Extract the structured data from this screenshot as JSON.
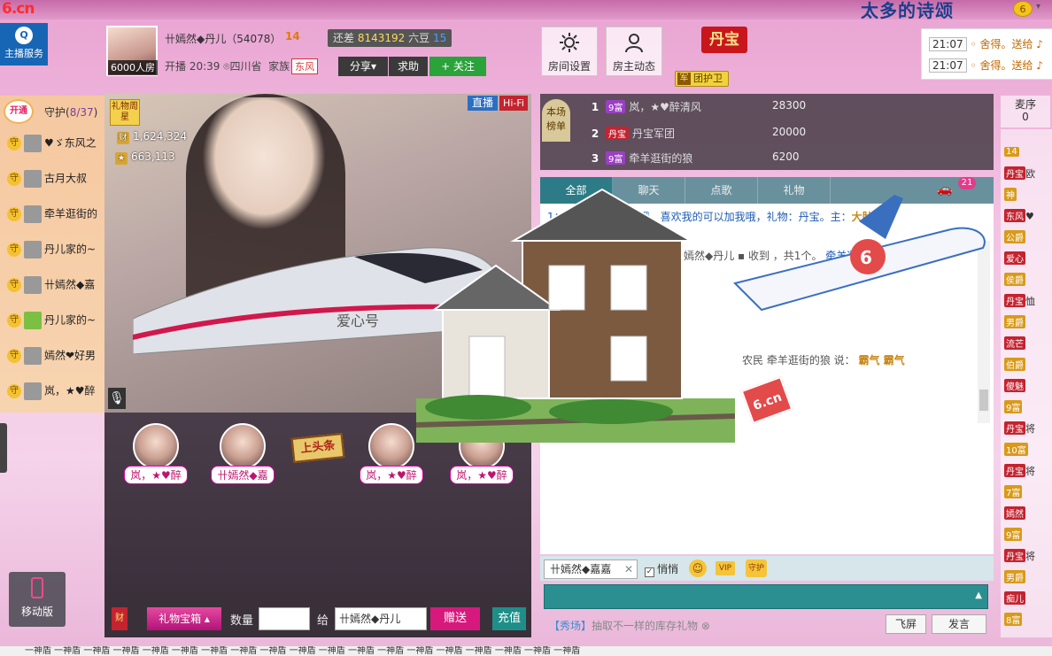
{
  "topbar": {
    "logo": "6.cn",
    "banner": "太多的诗颂",
    "coin_label": "6"
  },
  "anchor_service": {
    "label": "主播服务",
    "icon": "qq-icon"
  },
  "host": {
    "room_size": "6000人房",
    "name": "卄嫣然◆丹儿（54078）",
    "level": "14",
    "diff_prefix": "还差",
    "diff_value": "8143192",
    "diff_unit": "六豆",
    "next_level": "15",
    "live_time": "开播 20:39",
    "location": "四川省",
    "family_label": "家族",
    "family_name": "东风",
    "share": "分享▾",
    "ask": "求助",
    "follow": "+ 关注"
  },
  "tools": {
    "room_settings": "房间设置",
    "host_updates": "房主动态",
    "danbao": "丹宝",
    "guard": "团护卫",
    "guard_badge": "军"
  },
  "feed": [
    {
      "time": "21:07",
      "text": "◦ 舍得。送给 ♪"
    },
    {
      "time": "21:07",
      "text": "◦ 舍得。送给 ♪"
    }
  ],
  "guards": {
    "open_label": "开通",
    "title": "守护(",
    "count": "8/37",
    "close": ")",
    "items": [
      {
        "name": "♥ゞ东风之"
      },
      {
        "name": "古月大叔"
      },
      {
        "name": "牵羊逛街的"
      },
      {
        "name": "丹儿家的~"
      },
      {
        "name": "卄嫣然◆嘉"
      },
      {
        "name": "丹儿家的~"
      },
      {
        "name": "嫣然❤好男"
      },
      {
        "name": "岚，★♥醉"
      }
    ]
  },
  "video": {
    "gift_star": "礼物周星",
    "stat1": "1,624,324",
    "stat2": "663,113",
    "live_tag": "直播",
    "hifi_tag": "Hi-Fi",
    "train_label": "爱心号"
  },
  "stage": {
    "seats": [
      {
        "name": "岚，★♥醉"
      },
      {
        "name": "卄嫣然◆嘉"
      },
      {
        "name": "岚，★♥醉"
      },
      {
        "name": "岚，★♥醉"
      }
    ],
    "headline": "上头条"
  },
  "giftbar": {
    "treasure": "礼物宝箱",
    "qty_label": "数量",
    "to_label": "给",
    "to_value": "卄嫣然◆丹儿",
    "give": "赠送",
    "recharge": "充值",
    "fortune": "财"
  },
  "ranking": {
    "tab": "本场榜单",
    "rows": [
      {
        "rank": "1",
        "tag": "9富",
        "name": "岚，★♥醉清风",
        "score": "28300"
      },
      {
        "rank": "2",
        "tag": "丹宝",
        "name": "丹宝军团",
        "score": "20000"
      },
      {
        "rank": "3",
        "tag": "9富",
        "name": "牵羊逛街的狼",
        "score": "6200"
      }
    ]
  },
  "chat": {
    "tabs": [
      "全部",
      "聊天",
      "点歌",
      "礼物"
    ],
    "car_count": "21",
    "lines": [
      {
        "text": "1：公告：优惠多多哦，喜欢我的可以加我哦，礼物：丹宝。主：",
        "extra": "大肚男"
      },
      {
        "text": "卄嫣然◆丹儿 ▪ 收到 ，共1个。",
        "extra": "牵羊逛街的狼 的热情支"
      },
      {
        "text": "农民 牵羊逛街的狼 说：",
        "extra": "霸气 霸气"
      }
    ]
  },
  "chat_input": {
    "target": "卄嫣然◆嘉嘉",
    "quiet": "悄悄",
    "vip": "VIP",
    "guard_icon": "守护",
    "promo_key": "【秀场】",
    "promo_text": "抽取不一样的库存礼物",
    "flyscreen": "飞屏",
    "send": "发言"
  },
  "wheat": {
    "title": "麦序",
    "count": "0",
    "items": [
      {
        "tag": "14",
        "text": ""
      },
      {
        "tag": "丹宝",
        "text": "欧"
      },
      {
        "tag": "神",
        "text": ""
      },
      {
        "tag": "东风",
        "text": "♥"
      },
      {
        "tag": "公爵",
        "text": ""
      },
      {
        "tag": "爱心",
        "text": ""
      },
      {
        "tag": "侯爵",
        "text": ""
      },
      {
        "tag": "丹宝",
        "text": "恤"
      },
      {
        "tag": "男爵",
        "text": ""
      },
      {
        "tag": "流芒",
        "text": ""
      },
      {
        "tag": "伯爵",
        "text": ""
      },
      {
        "tag": "傻魅",
        "text": ""
      },
      {
        "tag": "9富",
        "text": ""
      },
      {
        "tag": "丹宝",
        "text": "将"
      },
      {
        "tag": "10富",
        "text": ""
      },
      {
        "tag": "丹宝",
        "text": "将"
      },
      {
        "tag": "7富",
        "text": ""
      },
      {
        "tag": "嫣然",
        "text": ""
      },
      {
        "tag": "9富",
        "text": ""
      },
      {
        "tag": "丹宝",
        "text": "将"
      },
      {
        "tag": "男爵",
        "text": ""
      },
      {
        "tag": "痴儿",
        "text": ""
      },
      {
        "tag": "8富",
        "text": ""
      }
    ]
  },
  "mobile": {
    "label": "移动版"
  },
  "bottom_strip": "一神盾 一神盾 一神盾 一神盾 一神盾 一神盾 一神盾 一神盾 一神盾 一神盾 一神盾 一神盾 一神盾 一神盾 一神盾 一神盾 一神盾 一神盾 一神盾"
}
